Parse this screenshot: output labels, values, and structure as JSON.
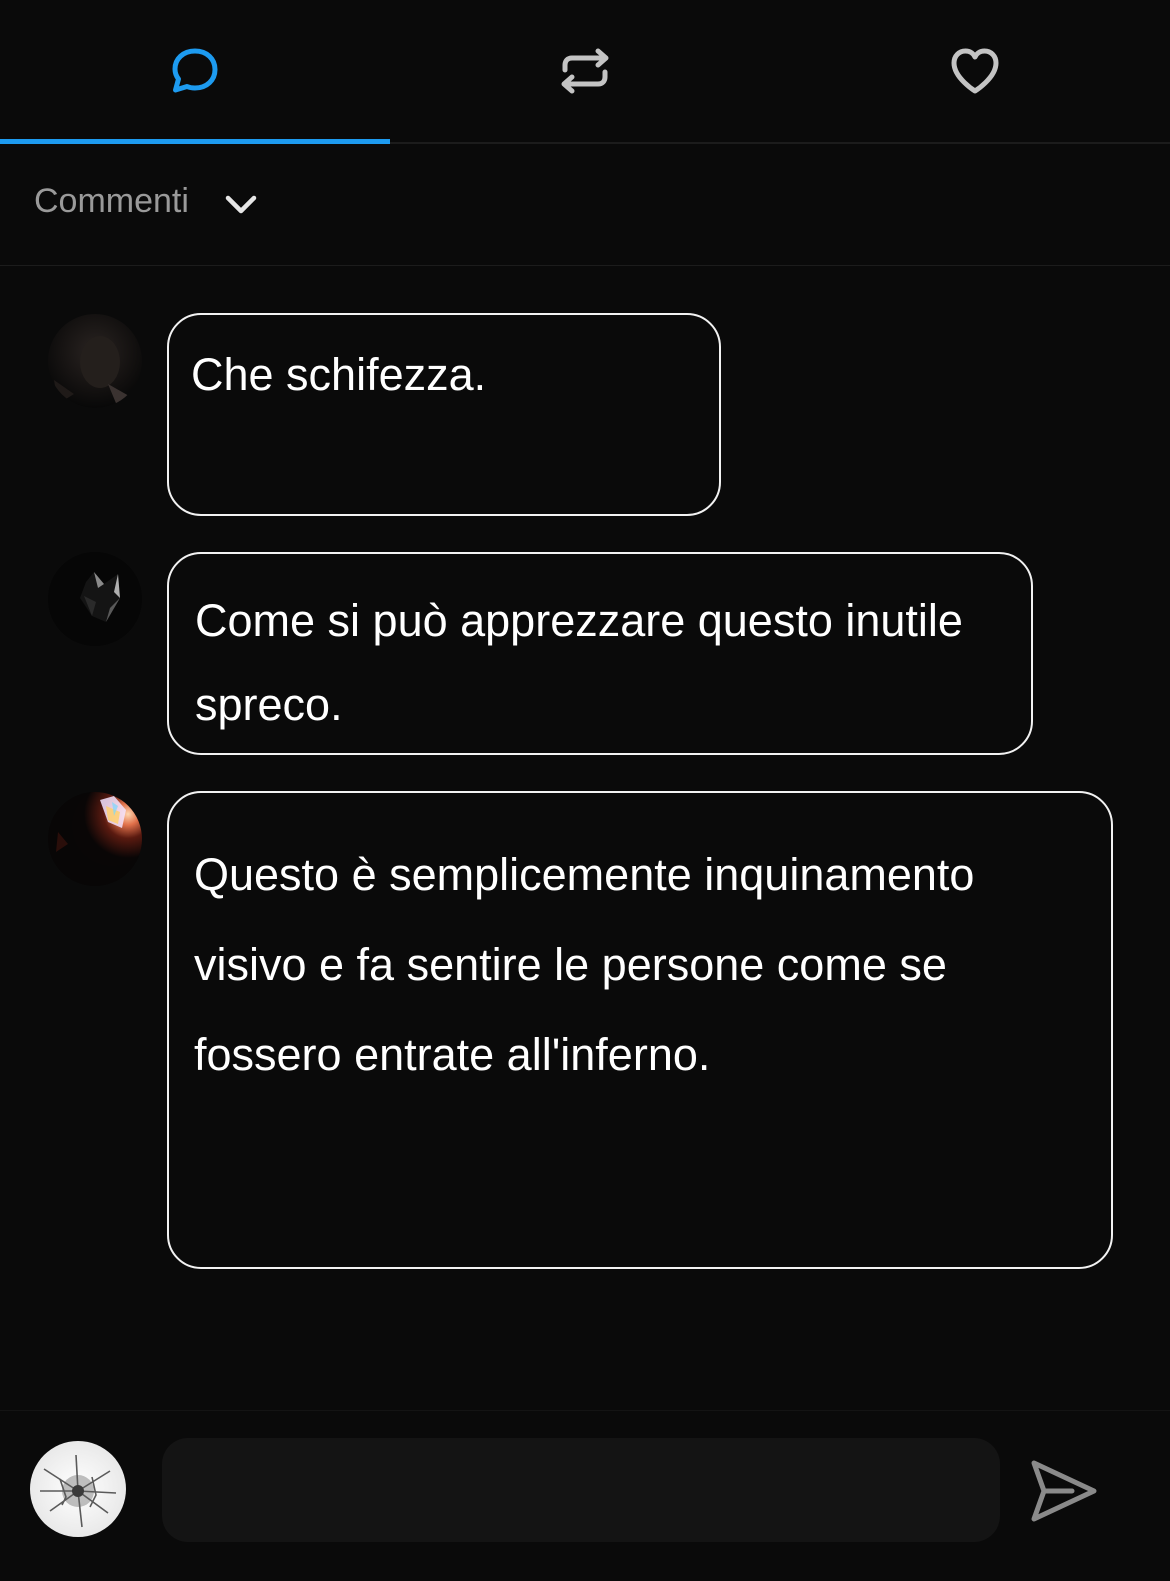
{
  "tabs": [
    {
      "id": "comments",
      "icon": "chat-bubble-icon",
      "active": true,
      "color": "#1d9bf0"
    },
    {
      "id": "reposts",
      "icon": "repost-icon",
      "active": false,
      "color": "#c4c4c4"
    },
    {
      "id": "likes",
      "icon": "heart-icon",
      "active": false,
      "color": "#c4c4c4"
    }
  ],
  "filter": {
    "label": "Commenti",
    "icon": "chevron-down-icon"
  },
  "comments": [
    {
      "text": "Che schifezza.",
      "avatar": "user-avatar-dark"
    },
    {
      "text": "Come si può apprezzare questo inutile spreco.",
      "avatar": "user-avatar-mask"
    },
    {
      "text": "Questo è semplicemente inquinamento visivo e fa sentire le persone come se fossero entrate all'inferno.",
      "avatar": "user-avatar-fire"
    }
  ],
  "composer": {
    "avatar": "own-avatar-cracked-glass",
    "placeholder": "",
    "send_icon": "send-icon"
  },
  "colors": {
    "background": "#0a0a0a",
    "accent": "#1d9bf0",
    "bubble_border": "#f2f2f2",
    "input_bg": "#141414"
  }
}
